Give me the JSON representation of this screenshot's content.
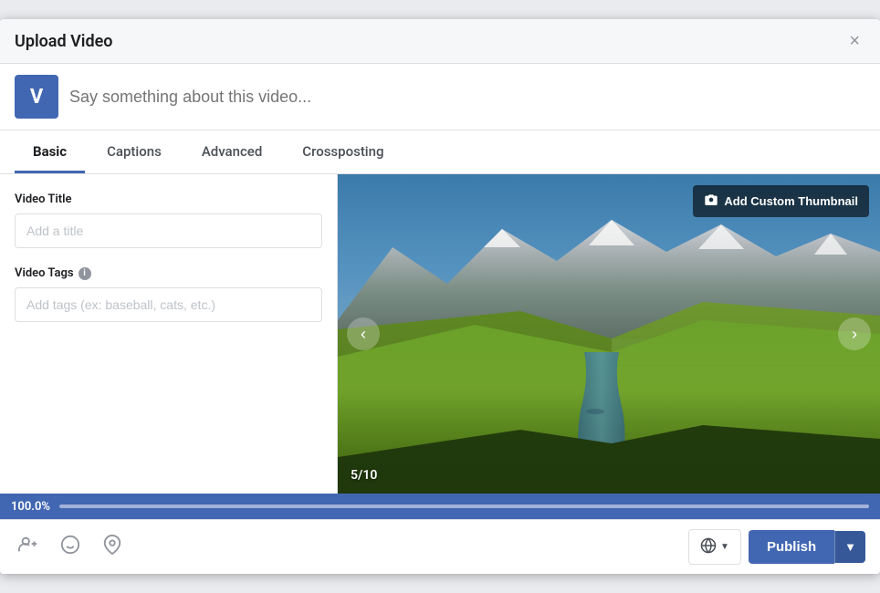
{
  "modal": {
    "title": "Upload Video",
    "close_label": "×"
  },
  "status_bar": {
    "avatar_letter": "V",
    "placeholder": "Say something about this video..."
  },
  "tabs": [
    {
      "id": "basic",
      "label": "Basic",
      "active": true
    },
    {
      "id": "captions",
      "label": "Captions",
      "active": false
    },
    {
      "id": "advanced",
      "label": "Advanced",
      "active": false
    },
    {
      "id": "crossposting",
      "label": "Crossposting",
      "active": false
    }
  ],
  "form": {
    "title_label": "Video Title",
    "title_placeholder": "Add a title",
    "tags_label": "Video Tags",
    "tags_info": "i",
    "tags_placeholder": "Add tags (ex: baseball, cats, etc.)"
  },
  "thumbnail": {
    "add_btn": "Add Custom Thumbnail",
    "slide_counter": "5/10"
  },
  "progress": {
    "value": "100.0%"
  },
  "footer": {
    "tag_people_icon": "👤+",
    "emoji_icon": "☺",
    "location_icon": "📍",
    "audience_icon": "🌐",
    "audience_dropdown": "▼",
    "publish_label": "Publish",
    "publish_dropdown": "▼"
  }
}
